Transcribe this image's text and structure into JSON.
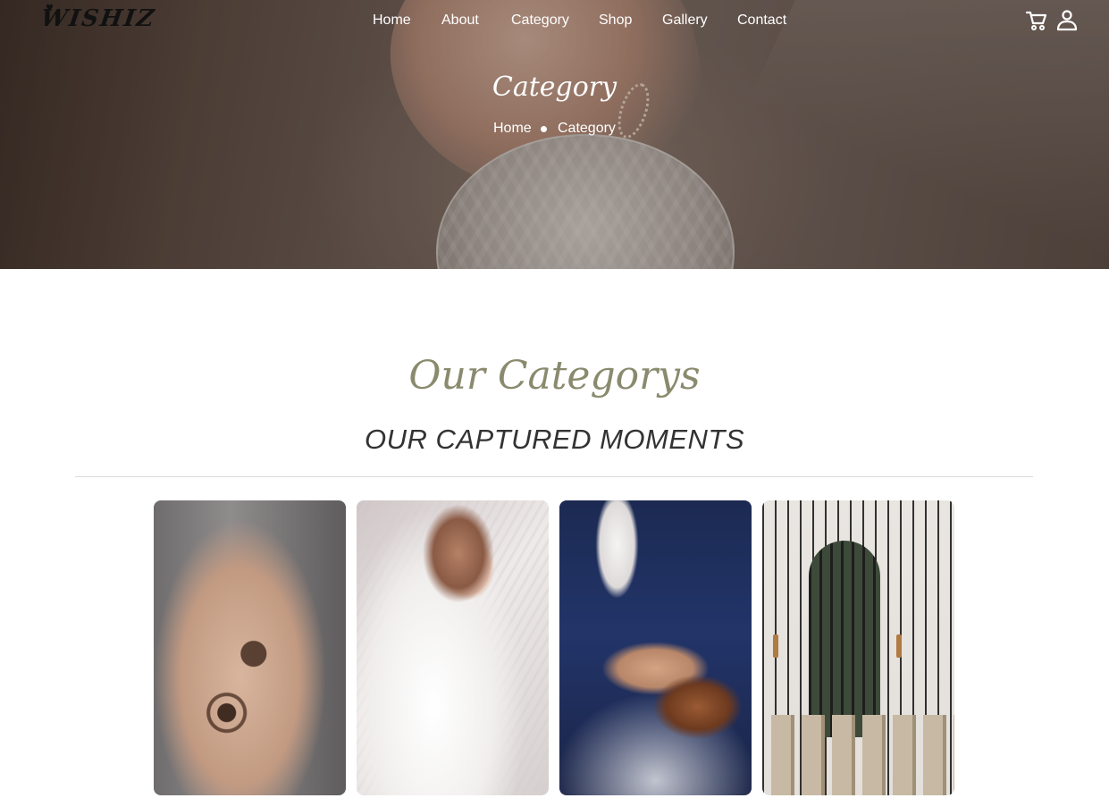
{
  "brand": {
    "logo_text": "WISHIZ"
  },
  "nav": {
    "items": [
      {
        "label": "Home"
      },
      {
        "label": "About"
      },
      {
        "label": "Category"
      },
      {
        "label": "Shop"
      },
      {
        "label": "Gallery"
      },
      {
        "label": "Contact"
      }
    ],
    "icons": [
      "cart-icon",
      "user-icon"
    ],
    "text_color": "#ffffff"
  },
  "hero": {
    "title": "Category",
    "breadcrumb": {
      "home": "Home",
      "current": "Category"
    }
  },
  "section": {
    "script_heading": "Our Categorys",
    "title": "OUR CAPTURED MOMENTS",
    "accent_color": "#8a8a6e"
  },
  "cards": [
    {
      "image": "mehndi-hand-photo"
    },
    {
      "image": "bride-veil-photo"
    },
    {
      "image": "groom-shoes-photo"
    },
    {
      "image": "venue-chairs-photo"
    }
  ]
}
